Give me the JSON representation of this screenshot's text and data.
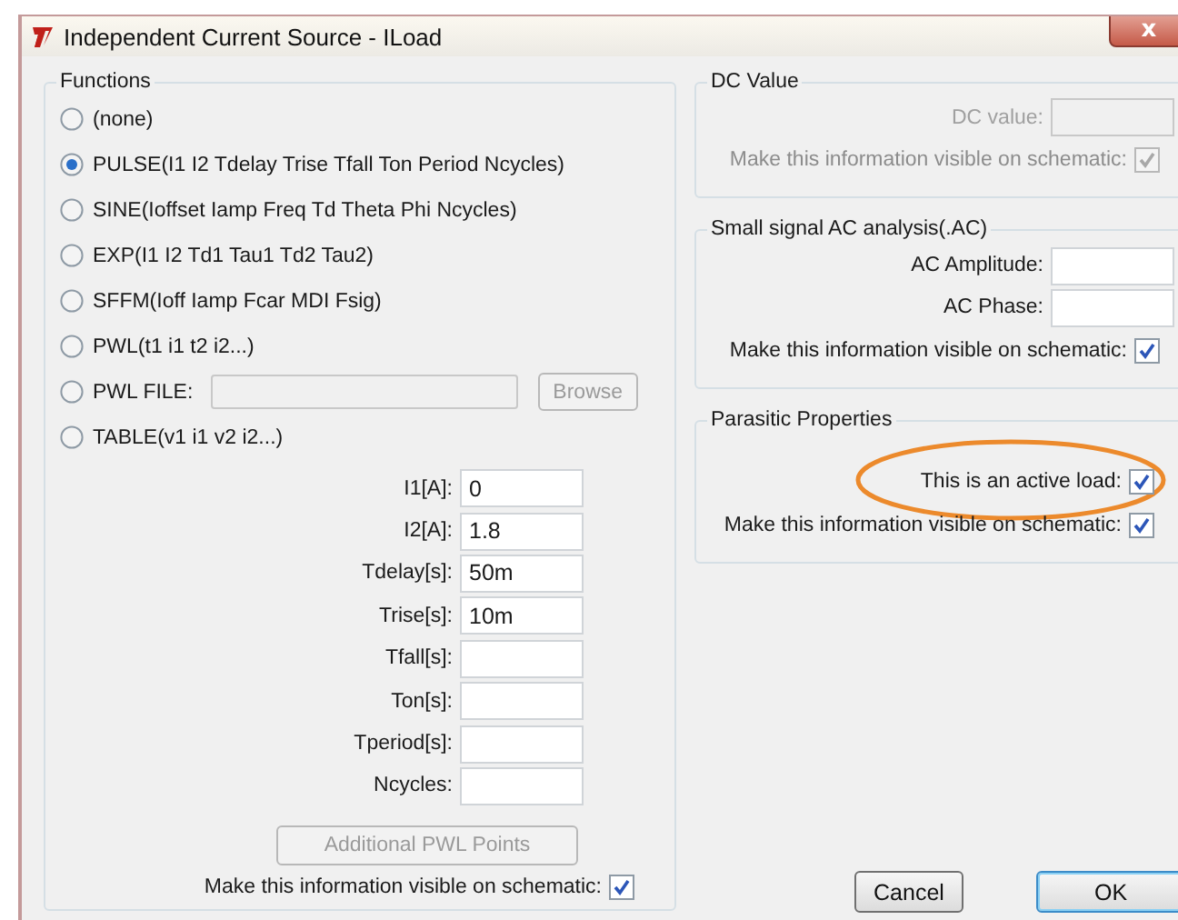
{
  "window": {
    "title": "Independent Current Source - ILoad",
    "close": "x"
  },
  "functions": {
    "title": "Functions",
    "options": [
      {
        "kind": "plain",
        "label": "(none)",
        "selected": false
      },
      {
        "kind": "plain",
        "label": "PULSE(I1 I2 Tdelay Trise Tfall Ton Period Ncycles)",
        "selected": true
      },
      {
        "kind": "plain",
        "label": "SINE(Ioffset Iamp Freq Td Theta Phi Ncycles)",
        "selected": false
      },
      {
        "kind": "plain",
        "label": "EXP(I1 I2 Td1 Tau1 Td2 Tau2)",
        "selected": false
      },
      {
        "kind": "plain",
        "label": "SFFM(Ioff Iamp Fcar MDI Fsig)",
        "selected": false
      },
      {
        "kind": "plain",
        "label": "PWL(t1 i1 t2 i2...)",
        "selected": false
      },
      {
        "kind": "file",
        "label": "PWL FILE:",
        "selected": false,
        "button": "Browse",
        "disabled": true
      },
      {
        "kind": "plain",
        "label": "TABLE(v1 i1 v2 i2...)",
        "selected": false
      }
    ],
    "params": [
      {
        "label": "I1[A]:",
        "value": "0"
      },
      {
        "label": "I2[A]:",
        "value": "1.8"
      },
      {
        "label": "Tdelay[s]:",
        "value": "50m"
      },
      {
        "label": "Trise[s]:",
        "value": "10m"
      },
      {
        "label": "Tfall[s]:"
      },
      {
        "label": "Ton[s]:"
      },
      {
        "label": "Tperiod[s]:"
      },
      {
        "label": "Ncycles:"
      }
    ],
    "pwl_button": {
      "label": "Additional PWL Points",
      "disabled": true
    },
    "visible": {
      "label": "Make this information visible on schematic:",
      "checked": true
    }
  },
  "dc_value": {
    "title": "DC Value",
    "disabled": true,
    "fields": [
      {
        "label": "DC value:"
      }
    ],
    "checks": [
      {
        "label": "Make this information visible on schematic:",
        "checked": true
      }
    ]
  },
  "ac_analysis": {
    "title": "Small signal AC analysis(.AC)",
    "fields": [
      {
        "label": "AC Amplitude:"
      },
      {
        "label": "AC Phase:"
      }
    ],
    "checks": [
      {
        "label": "Make this information visible on schematic:",
        "checked": true
      }
    ]
  },
  "parasitic": {
    "title": "Parasitic Properties",
    "checks": [
      {
        "label": "This is an active load:",
        "checked": true,
        "highlighted": true
      },
      {
        "label": "Make this information visible on schematic:",
        "checked": true
      }
    ]
  },
  "buttons": [
    {
      "label": "Cancel",
      "default": false
    },
    {
      "label": "OK",
      "default": true
    }
  ]
}
